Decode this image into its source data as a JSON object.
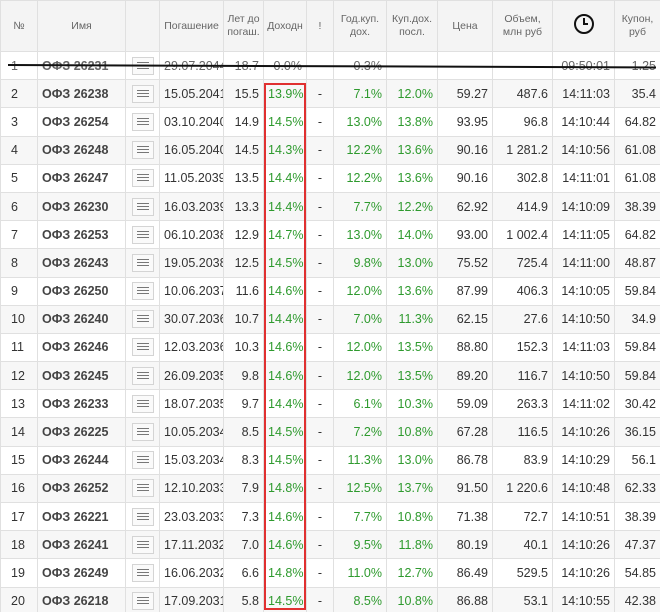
{
  "headers": {
    "num": "№",
    "name": "Имя",
    "maturity": "Погашение",
    "years": "Лет до погаш.",
    "yield": "Доходн",
    "excl": "!",
    "coupon_yield": "Год.куп. дох.",
    "last_coupon_yield": "Куп.дох. посл.",
    "price": "Цена",
    "volume": "Объем, млн руб",
    "time_icon": "clock-icon",
    "coupon": "Купон, руб"
  },
  "rows": [
    {
      "num": "1",
      "name": "ОФЗ 26231",
      "maturity": "29.07.2044",
      "years": "18.7",
      "yield": "0.0%",
      "excl": "",
      "coupon_yield": "0.3%",
      "last_coupon_yield": "",
      "price": "",
      "volume": "",
      "time": "09:50:01",
      "coupon": "1.25"
    },
    {
      "num": "2",
      "name": "ОФЗ 26238",
      "maturity": "15.05.2041",
      "years": "15.5",
      "yield": "13.9%",
      "excl": "-",
      "coupon_yield": "7.1%",
      "last_coupon_yield": "12.0%",
      "price": "59.27",
      "volume": "487.6",
      "time": "14:11:03",
      "coupon": "35.4"
    },
    {
      "num": "3",
      "name": "ОФЗ 26254",
      "maturity": "03.10.2040",
      "years": "14.9",
      "yield": "14.5%",
      "excl": "-",
      "coupon_yield": "13.0%",
      "last_coupon_yield": "13.8%",
      "price": "93.95",
      "volume": "96.8",
      "time": "14:10:44",
      "coupon": "64.82"
    },
    {
      "num": "4",
      "name": "ОФЗ 26248",
      "maturity": "16.05.2040",
      "years": "14.5",
      "yield": "14.3%",
      "excl": "-",
      "coupon_yield": "12.2%",
      "last_coupon_yield": "13.6%",
      "price": "90.16",
      "volume": "1 281.2",
      "time": "14:10:56",
      "coupon": "61.08"
    },
    {
      "num": "5",
      "name": "ОФЗ 26247",
      "maturity": "11.05.2039",
      "years": "13.5",
      "yield": "14.4%",
      "excl": "-",
      "coupon_yield": "12.2%",
      "last_coupon_yield": "13.6%",
      "price": "90.16",
      "volume": "302.8",
      "time": "14:11:01",
      "coupon": "61.08"
    },
    {
      "num": "6",
      "name": "ОФЗ 26230",
      "maturity": "16.03.2039",
      "years": "13.3",
      "yield": "14.4%",
      "excl": "-",
      "coupon_yield": "7.7%",
      "last_coupon_yield": "12.2%",
      "price": "62.92",
      "volume": "414.9",
      "time": "14:10:09",
      "coupon": "38.39"
    },
    {
      "num": "7",
      "name": "ОФЗ 26253",
      "maturity": "06.10.2038",
      "years": "12.9",
      "yield": "14.7%",
      "excl": "-",
      "coupon_yield": "13.0%",
      "last_coupon_yield": "14.0%",
      "price": "93.00",
      "volume": "1 002.4",
      "time": "14:11:05",
      "coupon": "64.82"
    },
    {
      "num": "8",
      "name": "ОФЗ 26243",
      "maturity": "19.05.2038",
      "years": "12.5",
      "yield": "14.5%",
      "excl": "-",
      "coupon_yield": "9.8%",
      "last_coupon_yield": "13.0%",
      "price": "75.52",
      "volume": "725.4",
      "time": "14:11:00",
      "coupon": "48.87"
    },
    {
      "num": "9",
      "name": "ОФЗ 26250",
      "maturity": "10.06.2037",
      "years": "11.6",
      "yield": "14.6%",
      "excl": "-",
      "coupon_yield": "12.0%",
      "last_coupon_yield": "13.6%",
      "price": "87.99",
      "volume": "406.3",
      "time": "14:10:05",
      "coupon": "59.84"
    },
    {
      "num": "10",
      "name": "ОФЗ 26240",
      "maturity": "30.07.2036",
      "years": "10.7",
      "yield": "14.4%",
      "excl": "-",
      "coupon_yield": "7.0%",
      "last_coupon_yield": "11.3%",
      "price": "62.15",
      "volume": "27.6",
      "time": "14:10:50",
      "coupon": "34.9"
    },
    {
      "num": "11",
      "name": "ОФЗ 26246",
      "maturity": "12.03.2036",
      "years": "10.3",
      "yield": "14.6%",
      "excl": "-",
      "coupon_yield": "12.0%",
      "last_coupon_yield": "13.5%",
      "price": "88.80",
      "volume": "152.3",
      "time": "14:11:03",
      "coupon": "59.84"
    },
    {
      "num": "12",
      "name": "ОФЗ 26245",
      "maturity": "26.09.2035",
      "years": "9.8",
      "yield": "14.6%",
      "excl": "-",
      "coupon_yield": "12.0%",
      "last_coupon_yield": "13.5%",
      "price": "89.20",
      "volume": "116.7",
      "time": "14:10:50",
      "coupon": "59.84"
    },
    {
      "num": "13",
      "name": "ОФЗ 26233",
      "maturity": "18.07.2035",
      "years": "9.7",
      "yield": "14.4%",
      "excl": "-",
      "coupon_yield": "6.1%",
      "last_coupon_yield": "10.3%",
      "price": "59.09",
      "volume": "263.3",
      "time": "14:11:02",
      "coupon": "30.42"
    },
    {
      "num": "14",
      "name": "ОФЗ 26225",
      "maturity": "10.05.2034",
      "years": "8.5",
      "yield": "14.5%",
      "excl": "-",
      "coupon_yield": "7.2%",
      "last_coupon_yield": "10.8%",
      "price": "67.28",
      "volume": "116.5",
      "time": "14:10:26",
      "coupon": "36.15"
    },
    {
      "num": "15",
      "name": "ОФЗ 26244",
      "maturity": "15.03.2034",
      "years": "8.3",
      "yield": "14.5%",
      "excl": "-",
      "coupon_yield": "11.3%",
      "last_coupon_yield": "13.0%",
      "price": "86.78",
      "volume": "83.9",
      "time": "14:10:29",
      "coupon": "56.1"
    },
    {
      "num": "16",
      "name": "ОФЗ 26252",
      "maturity": "12.10.2033",
      "years": "7.9",
      "yield": "14.8%",
      "excl": "-",
      "coupon_yield": "12.5%",
      "last_coupon_yield": "13.7%",
      "price": "91.50",
      "volume": "1 220.6",
      "time": "14:10:48",
      "coupon": "62.33"
    },
    {
      "num": "17",
      "name": "ОФЗ 26221",
      "maturity": "23.03.2033",
      "years": "7.3",
      "yield": "14.6%",
      "excl": "-",
      "coupon_yield": "7.7%",
      "last_coupon_yield": "10.8%",
      "price": "71.38",
      "volume": "72.7",
      "time": "14:10:51",
      "coupon": "38.39"
    },
    {
      "num": "18",
      "name": "ОФЗ 26241",
      "maturity": "17.11.2032",
      "years": "7.0",
      "yield": "14.6%",
      "excl": "-",
      "coupon_yield": "9.5%",
      "last_coupon_yield": "11.8%",
      "price": "80.19",
      "volume": "40.1",
      "time": "14:10:26",
      "coupon": "47.37"
    },
    {
      "num": "19",
      "name": "ОФЗ 26249",
      "maturity": "16.06.2032",
      "years": "6.6",
      "yield": "14.8%",
      "excl": "-",
      "coupon_yield": "11.0%",
      "last_coupon_yield": "12.7%",
      "price": "86.49",
      "volume": "529.5",
      "time": "14:10:26",
      "coupon": "54.85"
    },
    {
      "num": "20",
      "name": "ОФЗ 26218",
      "maturity": "17.09.2031",
      "years": "5.8",
      "yield": "14.5%",
      "excl": "-",
      "coupon_yield": "8.5%",
      "last_coupon_yield": "10.8%",
      "price": "86.88",
      "volume": "53.1",
      "time": "14:10:55",
      "coupon": "42.38"
    }
  ]
}
